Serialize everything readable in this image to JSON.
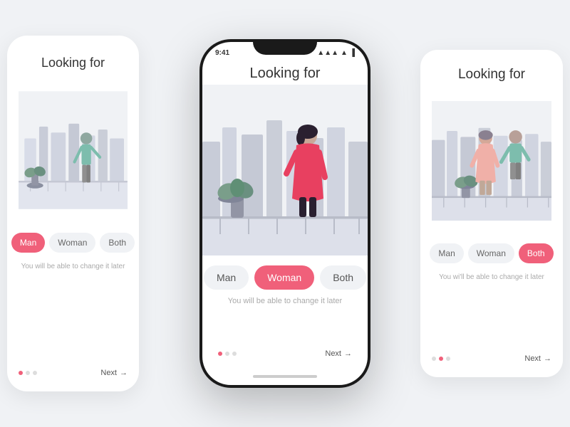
{
  "app": {
    "title": "Looking for"
  },
  "phone": {
    "status_time": "9:41",
    "title": "Looking for",
    "gender_options": [
      "Man",
      "Woman",
      "Both"
    ],
    "active_option": "Woman",
    "change_later_text": "You will be able to change it later",
    "next_label": "Next",
    "dots": [
      true,
      false,
      false
    ]
  },
  "left_card": {
    "title": "Looking for",
    "active_option": "Man",
    "gender_options": [
      "Man",
      "Woman",
      "Both"
    ],
    "change_later_text": "You will be able to change it later",
    "next_label": "Next",
    "dots": [
      true,
      false,
      false
    ]
  },
  "right_card": {
    "title": "Looking for",
    "active_option": "Both",
    "gender_options": [
      "Man",
      "Woman",
      "Both"
    ],
    "change_later_text": "You wi'll be able to change it later",
    "next_label": "Next",
    "dots": [
      false,
      true,
      false
    ]
  },
  "colors": {
    "accent": "#f0607a",
    "bg": "#f0f2f5",
    "text_primary": "#333",
    "text_muted": "#aaa"
  }
}
